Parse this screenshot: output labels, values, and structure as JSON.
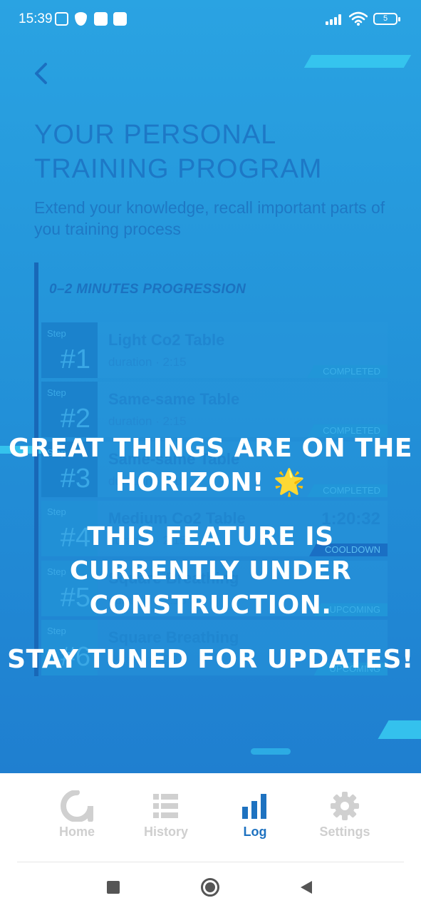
{
  "status_bar": {
    "time": "15:39",
    "battery": "5",
    "icons": [
      "nfc-icon",
      "vpn-shield-icon",
      "app-notification-icon",
      "camera-icon",
      "signal-icon",
      "wifi-icon",
      "battery-icon"
    ]
  },
  "header": {
    "back_icon": "chevron-left-icon",
    "title": "YOUR PERSONAL TRAINING PROGRAM",
    "subtitle": "Extend your knowledge, recall important parts of you training process"
  },
  "program": {
    "heading": "0–2 MINUTES PROGRESSION",
    "step_label": "Step",
    "steps": [
      {
        "number": "#1",
        "name": "Light Co2 Table",
        "duration": "duration · 2:15",
        "status": "COMPLETED"
      },
      {
        "number": "#2",
        "name": "Same-same Table",
        "duration": "duration · 2:15",
        "status": "COMPLETED"
      },
      {
        "number": "#3",
        "name": "Same-same Table",
        "duration": "duration · 2:15",
        "status": "COMPLETED"
      },
      {
        "number": "#4",
        "name": "Medium Co2 Table",
        "duration": "duration · 2:15",
        "status": "COOLDOWN",
        "timer": "1:20:32"
      },
      {
        "number": "#5",
        "name": "Square Breathing",
        "duration": "duration · 2:15",
        "status": "UPCOMING"
      },
      {
        "number": "#6",
        "name": "Square Breathing",
        "duration": "duration · 2:15",
        "status": "UPCOMING"
      }
    ]
  },
  "overlay": {
    "line1": "GREAT THINGS ARE ON THE HORIZON! 🌟",
    "line2": "THIS FEATURE IS CURRENTLY UNDER CONSTRUCTION.",
    "line3": "STAY TUNED FOR UPDATES!"
  },
  "bottom_nav": {
    "items": [
      {
        "label": "Home",
        "icon": "home-logo-icon",
        "active": false
      },
      {
        "label": "History",
        "icon": "list-icon",
        "active": false
      },
      {
        "label": "Log",
        "icon": "bar-chart-icon",
        "active": true
      },
      {
        "label": "Settings",
        "icon": "gear-icon",
        "active": false
      }
    ]
  },
  "system_nav": {
    "icons": [
      "recents-square-icon",
      "home-circle-icon",
      "back-triangle-icon"
    ]
  },
  "colors": {
    "background_top": "#2aa3e2",
    "background_bottom": "#1f7fd0",
    "accent": "#1e72c0",
    "overlay_text": "#ffffff",
    "inactive_nav": "#cfcfcf"
  }
}
